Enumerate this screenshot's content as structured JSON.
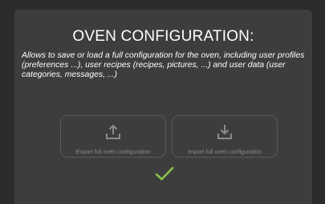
{
  "dialog": {
    "title": "OVEN CONFIGURATION:",
    "description": "Allows to save or load a full configuration for the oven, including user profiles (preferences ...), user recipes (recipes, pictures, ...) and user data (user categories, messages, ...)"
  },
  "actions": [
    {
      "label": "Export full oven configuration",
      "icon": "export-icon"
    },
    {
      "label": "Import full oven configuration",
      "icon": "import-icon"
    }
  ],
  "confirm": {
    "icon": "checkmark-icon"
  },
  "colors": {
    "background": "#2b2b2b",
    "panel": "#3d3d3d",
    "button_border": "#5a5a5a",
    "muted_text": "#8a8a8a",
    "accent": "#8bc34a"
  }
}
